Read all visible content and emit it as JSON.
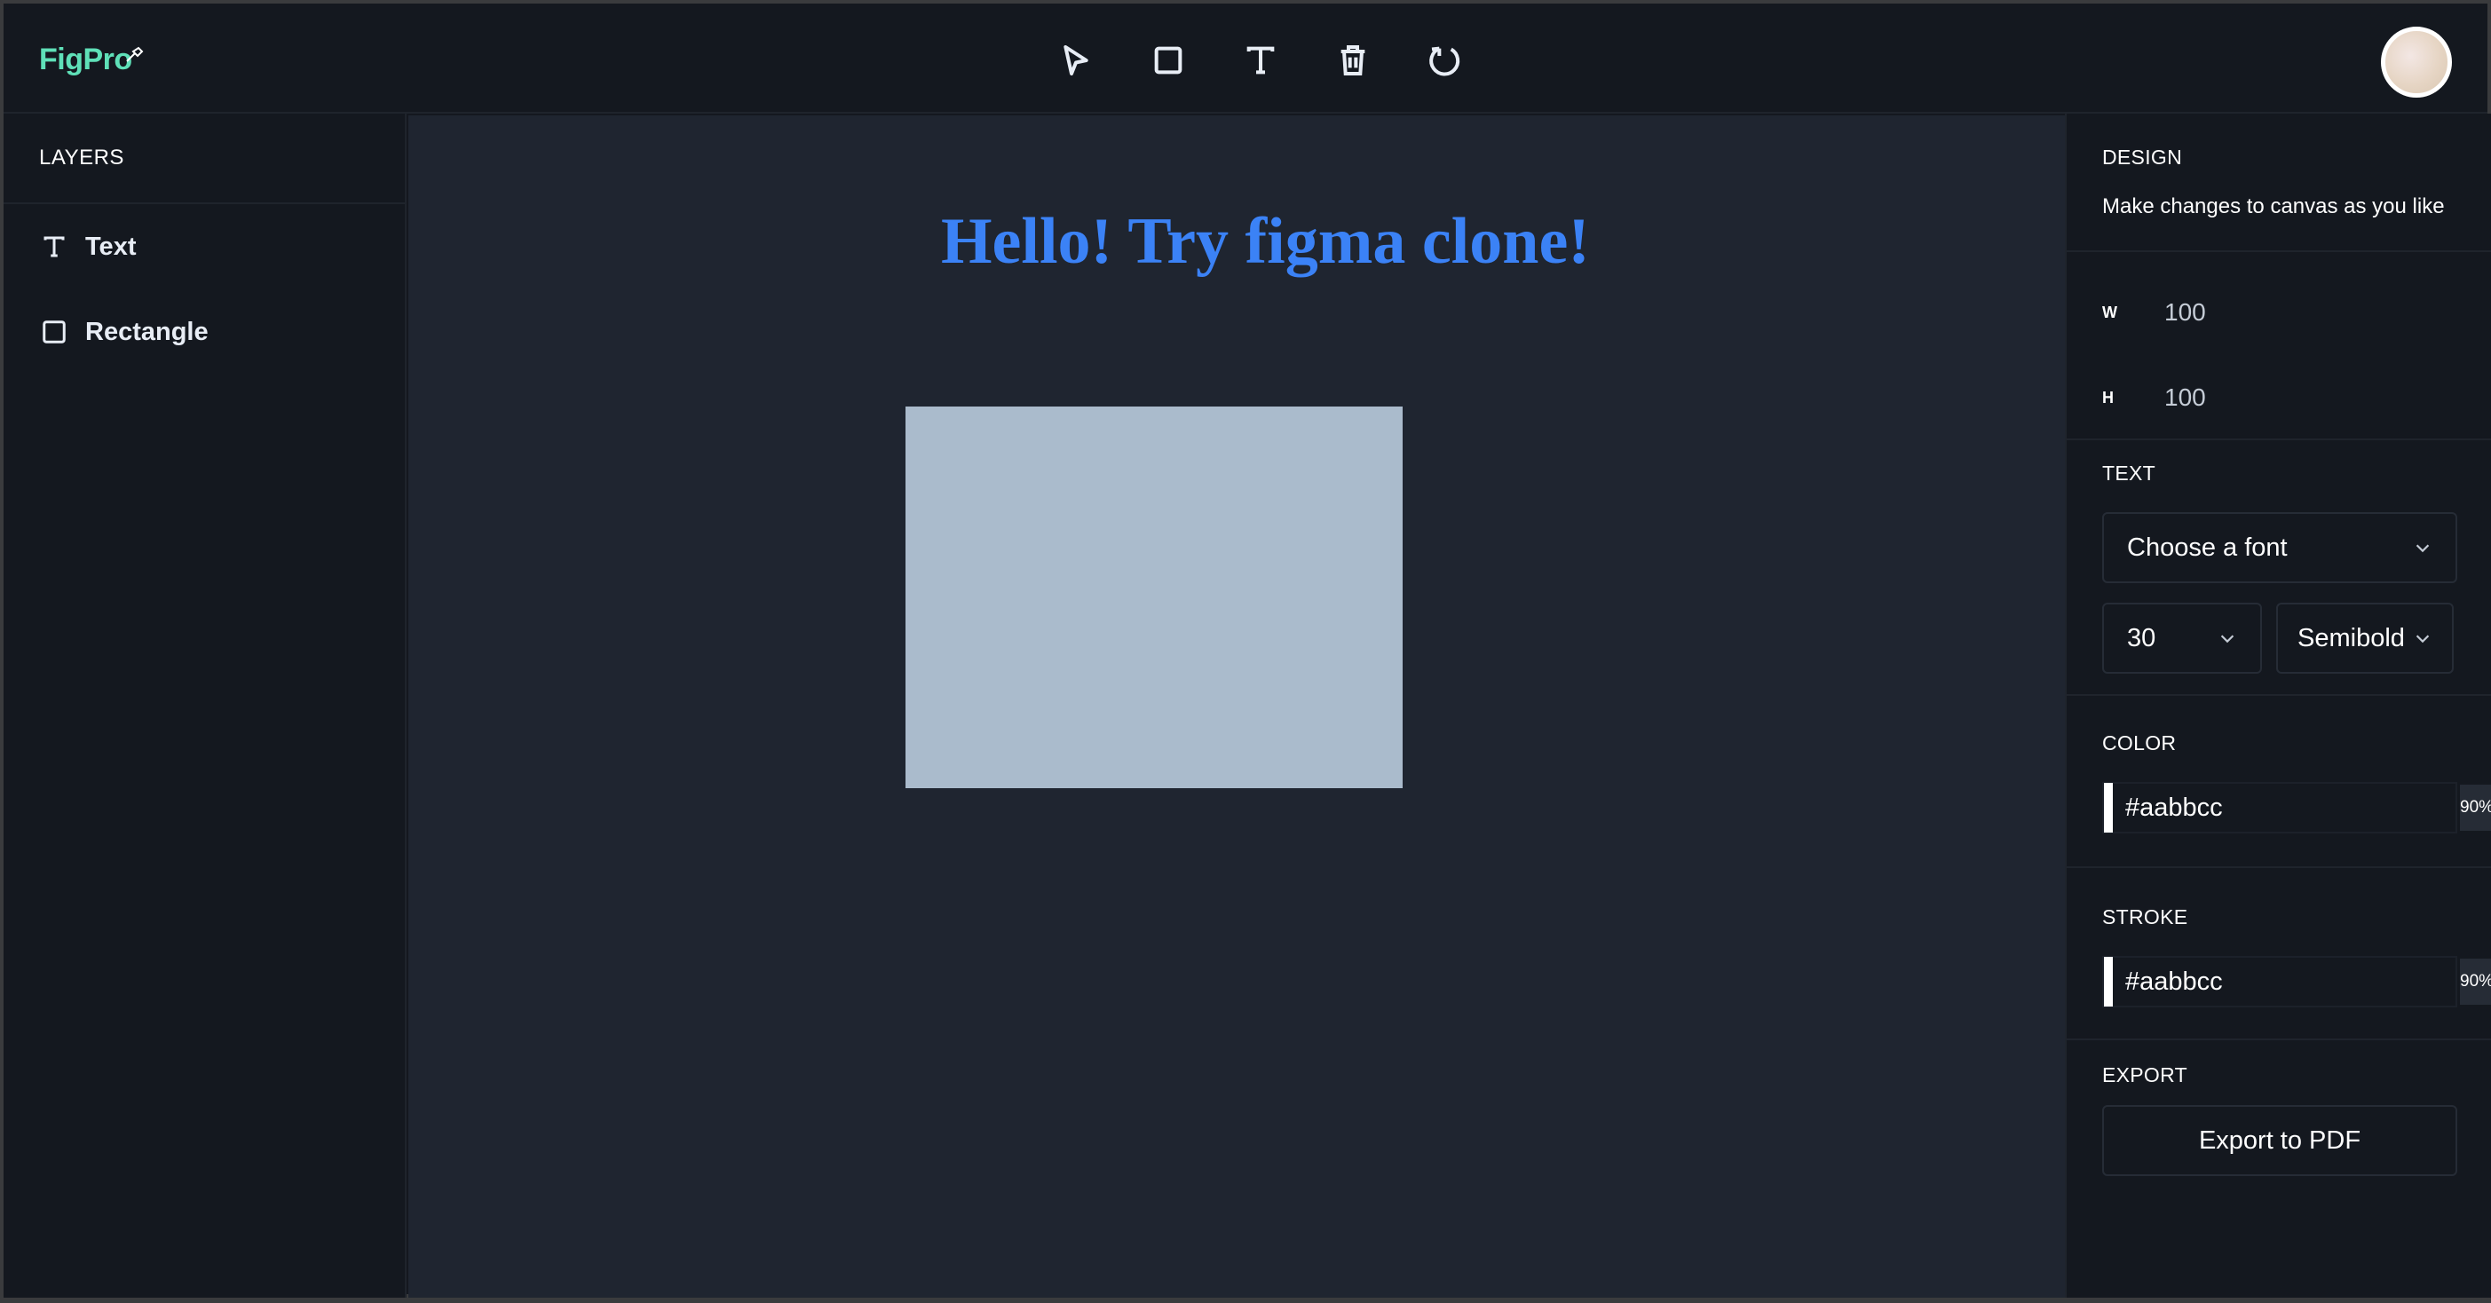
{
  "app": {
    "logo": "FigPro"
  },
  "toolbar": {
    "tools": [
      {
        "name": "select-tool",
        "icon": "cursor-icon"
      },
      {
        "name": "rectangle-tool",
        "icon": "square-icon"
      },
      {
        "name": "text-tool",
        "icon": "text-icon"
      },
      {
        "name": "delete-tool",
        "icon": "trash-icon"
      },
      {
        "name": "reset-tool",
        "icon": "rotate-icon"
      }
    ]
  },
  "layers": {
    "title": "LAYERS",
    "items": [
      {
        "label": "Text",
        "icon": "text-icon"
      },
      {
        "label": "Rectangle",
        "icon": "square-icon"
      }
    ]
  },
  "canvas": {
    "text": "Hello! Try figma clone!",
    "text_color": "#3b82f6",
    "rect_color": "#aabbcc"
  },
  "design": {
    "title": "DESIGN",
    "subtitle": "Make changes to canvas as you like",
    "width_label": "W",
    "width_value": "100",
    "height_label": "H",
    "height_value": "100",
    "text_section": {
      "title": "TEXT",
      "font_placeholder": "Choose a font",
      "font_size": "30",
      "font_weight": "Semibold"
    },
    "color": {
      "title": "COLOR",
      "hex": "#aabbcc",
      "opacity": "90%"
    },
    "stroke": {
      "title": "STROKE",
      "hex": "#aabbcc",
      "opacity": "90%"
    },
    "export": {
      "title": "EXPORT",
      "button": "Export to PDF"
    }
  },
  "colors": {
    "background": "#14181f",
    "canvas": "#1f2530",
    "accent": "#5fe0b8",
    "heading": "#3b82f6"
  }
}
